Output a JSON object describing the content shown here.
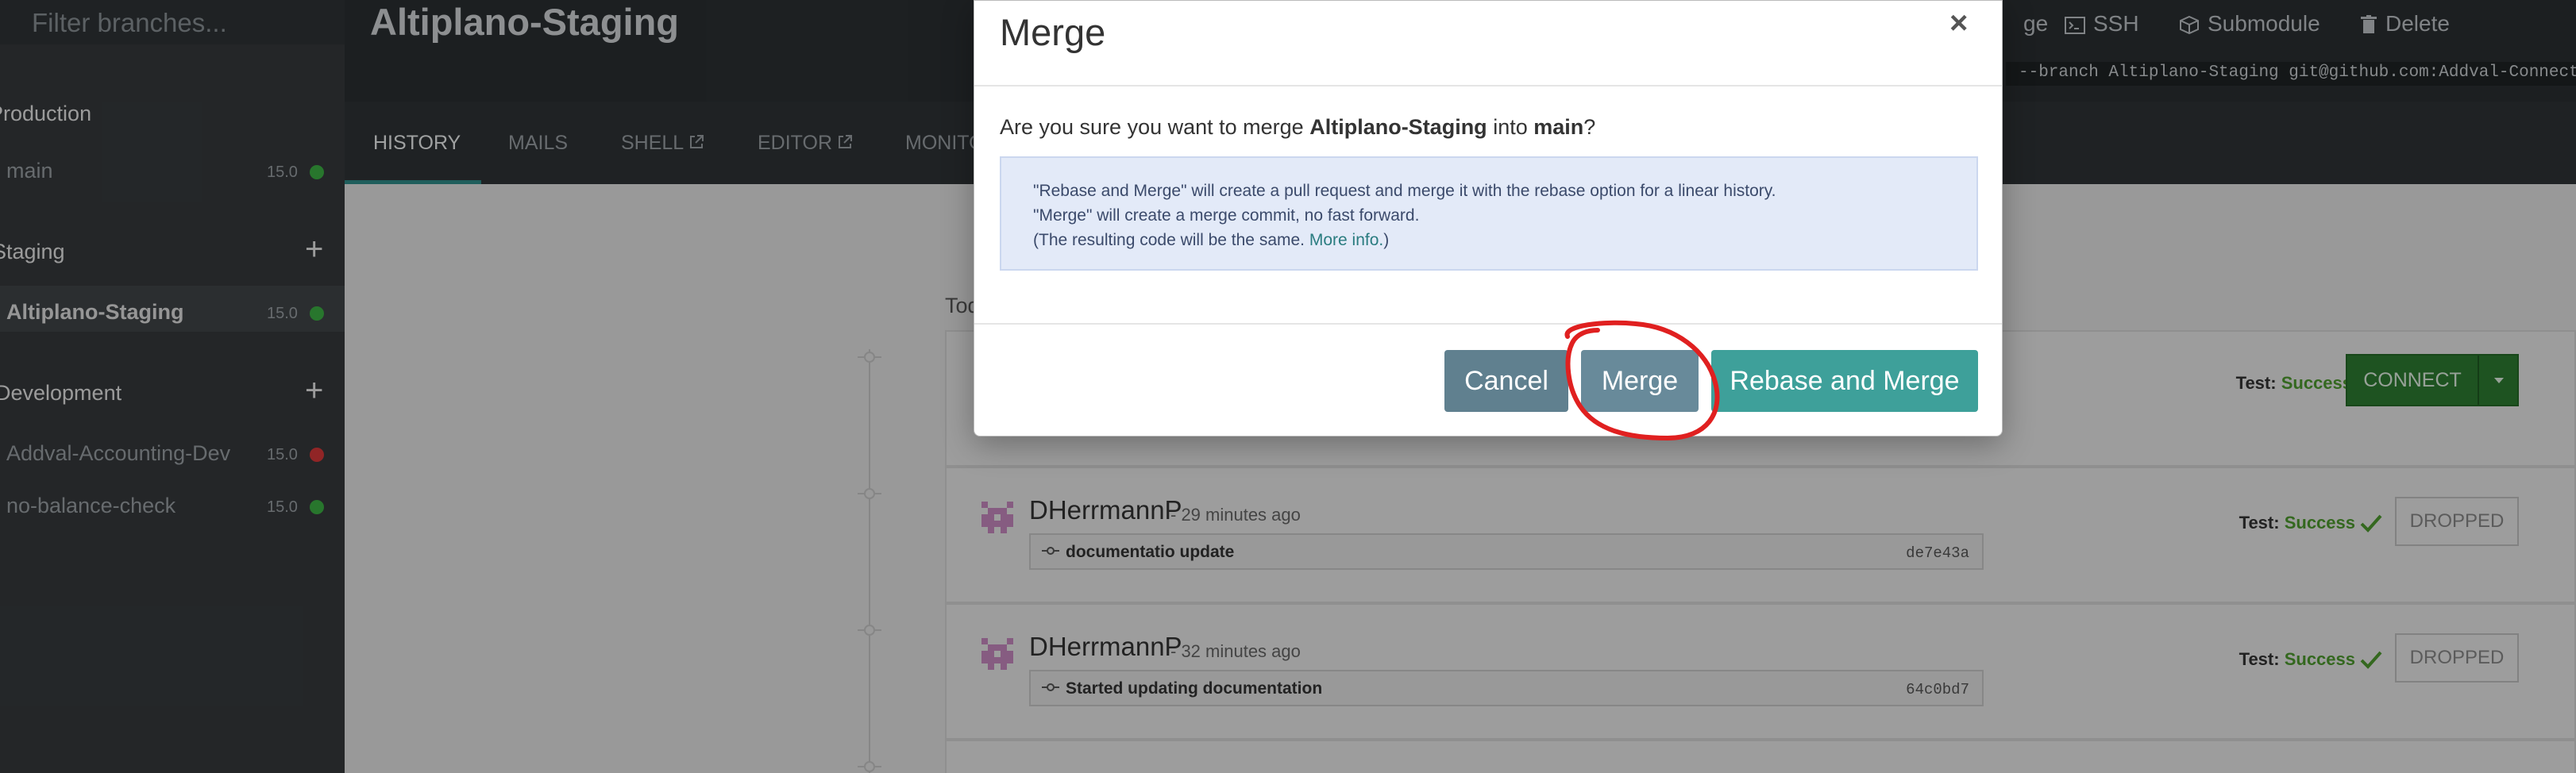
{
  "sidebar": {
    "filter_placeholder": "Filter branches...",
    "sections": [
      {
        "title": "Production",
        "branches": [
          {
            "name": "main",
            "version": "15.0",
            "status": "green"
          }
        ]
      },
      {
        "title": "Staging",
        "add_icon": "plus-icon",
        "branches": [
          {
            "name": "Altiplano-Staging",
            "version": "15.0",
            "status": "green",
            "active": true
          }
        ]
      },
      {
        "title": "Development",
        "add_icon": "plus-icon",
        "branches": [
          {
            "name": "Addval-Accounting-Dev",
            "version": "15.0",
            "status": "red"
          },
          {
            "name": "no-balance-check",
            "version": "15.0",
            "status": "green"
          }
        ]
      }
    ]
  },
  "header": {
    "branch_title": "Altiplano-Staging",
    "actions": {
      "merge": "ge",
      "ssh": "SSH",
      "submodule": "Submodule",
      "delete": "Delete"
    },
    "clone_command": "--branch Altiplano-Staging git@github.com:Addval-Connect/altiplano"
  },
  "tabs": [
    {
      "label": "HISTORY",
      "active": true
    },
    {
      "label": "MAILS"
    },
    {
      "label": "SHELL",
      "icon": "external-link-icon"
    },
    {
      "label": "EDITOR",
      "icon": "external-link-icon"
    },
    {
      "label": "MONITOR"
    }
  ],
  "history": {
    "day_label": "Today",
    "builds": [
      {
        "author": "",
        "ago": "",
        "message": "",
        "sha": "",
        "test_label": "Test:",
        "test_status": "Success",
        "action": "CONNECT"
      },
      {
        "author": "DHerrmannP",
        "ago": "- 29 minutes ago",
        "message": "documentatio update",
        "sha": "de7e43a",
        "test_label": "Test:",
        "test_status": "Success",
        "action": "DROPPED"
      },
      {
        "author": "DHerrmannP",
        "ago": "- 32 minutes ago",
        "message": "Started updating documentation",
        "sha": "64c0bd7",
        "test_label": "Test:",
        "test_status": "Success",
        "action": "DROPPED"
      }
    ]
  },
  "modal": {
    "title": "Merge",
    "close": "×",
    "question": {
      "prefix": "Are you sure you want to merge ",
      "source": "Altiplano-Staging",
      "middle": " into ",
      "target": "main",
      "suffix": "?"
    },
    "info": {
      "line1": "\"Rebase and Merge\" will create a pull request and merge it with the rebase option for a linear history.",
      "line2": "\"Merge\" will create a merge commit, no fast forward.",
      "line3_prefix": "(The resulting code will be the same. ",
      "line3_link": "More info.",
      "line3_suffix": ")"
    },
    "buttons": {
      "cancel": "Cancel",
      "merge": "Merge",
      "rebase_merge": "Rebase and Merge"
    }
  },
  "colors": {
    "accent": "#2f8d89",
    "success": "#4e9b2f",
    "status_green": "#3cb043",
    "status_red": "#d9383a",
    "annotation_red": "#e02020"
  }
}
